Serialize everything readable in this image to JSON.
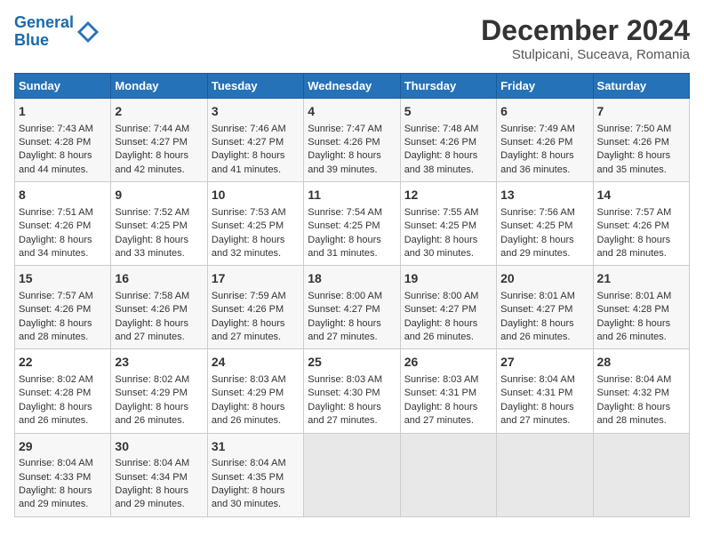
{
  "logo": {
    "line1": "General",
    "line2": "Blue"
  },
  "title": "December 2024",
  "subtitle": "Stulpicani, Suceava, Romania",
  "weekdays": [
    "Sunday",
    "Monday",
    "Tuesday",
    "Wednesday",
    "Thursday",
    "Friday",
    "Saturday"
  ],
  "weeks": [
    [
      {
        "day": "1",
        "lines": [
          "Sunrise: 7:43 AM",
          "Sunset: 4:28 PM",
          "Daylight: 8 hours",
          "and 44 minutes."
        ]
      },
      {
        "day": "2",
        "lines": [
          "Sunrise: 7:44 AM",
          "Sunset: 4:27 PM",
          "Daylight: 8 hours",
          "and 42 minutes."
        ]
      },
      {
        "day": "3",
        "lines": [
          "Sunrise: 7:46 AM",
          "Sunset: 4:27 PM",
          "Daylight: 8 hours",
          "and 41 minutes."
        ]
      },
      {
        "day": "4",
        "lines": [
          "Sunrise: 7:47 AM",
          "Sunset: 4:26 PM",
          "Daylight: 8 hours",
          "and 39 minutes."
        ]
      },
      {
        "day": "5",
        "lines": [
          "Sunrise: 7:48 AM",
          "Sunset: 4:26 PM",
          "Daylight: 8 hours",
          "and 38 minutes."
        ]
      },
      {
        "day": "6",
        "lines": [
          "Sunrise: 7:49 AM",
          "Sunset: 4:26 PM",
          "Daylight: 8 hours",
          "and 36 minutes."
        ]
      },
      {
        "day": "7",
        "lines": [
          "Sunrise: 7:50 AM",
          "Sunset: 4:26 PM",
          "Daylight: 8 hours",
          "and 35 minutes."
        ]
      }
    ],
    [
      {
        "day": "8",
        "lines": [
          "Sunrise: 7:51 AM",
          "Sunset: 4:26 PM",
          "Daylight: 8 hours",
          "and 34 minutes."
        ]
      },
      {
        "day": "9",
        "lines": [
          "Sunrise: 7:52 AM",
          "Sunset: 4:25 PM",
          "Daylight: 8 hours",
          "and 33 minutes."
        ]
      },
      {
        "day": "10",
        "lines": [
          "Sunrise: 7:53 AM",
          "Sunset: 4:25 PM",
          "Daylight: 8 hours",
          "and 32 minutes."
        ]
      },
      {
        "day": "11",
        "lines": [
          "Sunrise: 7:54 AM",
          "Sunset: 4:25 PM",
          "Daylight: 8 hours",
          "and 31 minutes."
        ]
      },
      {
        "day": "12",
        "lines": [
          "Sunrise: 7:55 AM",
          "Sunset: 4:25 PM",
          "Daylight: 8 hours",
          "and 30 minutes."
        ]
      },
      {
        "day": "13",
        "lines": [
          "Sunrise: 7:56 AM",
          "Sunset: 4:25 PM",
          "Daylight: 8 hours",
          "and 29 minutes."
        ]
      },
      {
        "day": "14",
        "lines": [
          "Sunrise: 7:57 AM",
          "Sunset: 4:26 PM",
          "Daylight: 8 hours",
          "and 28 minutes."
        ]
      }
    ],
    [
      {
        "day": "15",
        "lines": [
          "Sunrise: 7:57 AM",
          "Sunset: 4:26 PM",
          "Daylight: 8 hours",
          "and 28 minutes."
        ]
      },
      {
        "day": "16",
        "lines": [
          "Sunrise: 7:58 AM",
          "Sunset: 4:26 PM",
          "Daylight: 8 hours",
          "and 27 minutes."
        ]
      },
      {
        "day": "17",
        "lines": [
          "Sunrise: 7:59 AM",
          "Sunset: 4:26 PM",
          "Daylight: 8 hours",
          "and 27 minutes."
        ]
      },
      {
        "day": "18",
        "lines": [
          "Sunrise: 8:00 AM",
          "Sunset: 4:27 PM",
          "Daylight: 8 hours",
          "and 27 minutes."
        ]
      },
      {
        "day": "19",
        "lines": [
          "Sunrise: 8:00 AM",
          "Sunset: 4:27 PM",
          "Daylight: 8 hours",
          "and 26 minutes."
        ]
      },
      {
        "day": "20",
        "lines": [
          "Sunrise: 8:01 AM",
          "Sunset: 4:27 PM",
          "Daylight: 8 hours",
          "and 26 minutes."
        ]
      },
      {
        "day": "21",
        "lines": [
          "Sunrise: 8:01 AM",
          "Sunset: 4:28 PM",
          "Daylight: 8 hours",
          "and 26 minutes."
        ]
      }
    ],
    [
      {
        "day": "22",
        "lines": [
          "Sunrise: 8:02 AM",
          "Sunset: 4:28 PM",
          "Daylight: 8 hours",
          "and 26 minutes."
        ]
      },
      {
        "day": "23",
        "lines": [
          "Sunrise: 8:02 AM",
          "Sunset: 4:29 PM",
          "Daylight: 8 hours",
          "and 26 minutes."
        ]
      },
      {
        "day": "24",
        "lines": [
          "Sunrise: 8:03 AM",
          "Sunset: 4:29 PM",
          "Daylight: 8 hours",
          "and 26 minutes."
        ]
      },
      {
        "day": "25",
        "lines": [
          "Sunrise: 8:03 AM",
          "Sunset: 4:30 PM",
          "Daylight: 8 hours",
          "and 27 minutes."
        ]
      },
      {
        "day": "26",
        "lines": [
          "Sunrise: 8:03 AM",
          "Sunset: 4:31 PM",
          "Daylight: 8 hours",
          "and 27 minutes."
        ]
      },
      {
        "day": "27",
        "lines": [
          "Sunrise: 8:04 AM",
          "Sunset: 4:31 PM",
          "Daylight: 8 hours",
          "and 27 minutes."
        ]
      },
      {
        "day": "28",
        "lines": [
          "Sunrise: 8:04 AM",
          "Sunset: 4:32 PM",
          "Daylight: 8 hours",
          "and 28 minutes."
        ]
      }
    ],
    [
      {
        "day": "29",
        "lines": [
          "Sunrise: 8:04 AM",
          "Sunset: 4:33 PM",
          "Daylight: 8 hours",
          "and 29 minutes."
        ]
      },
      {
        "day": "30",
        "lines": [
          "Sunrise: 8:04 AM",
          "Sunset: 4:34 PM",
          "Daylight: 8 hours",
          "and 29 minutes."
        ]
      },
      {
        "day": "31",
        "lines": [
          "Sunrise: 8:04 AM",
          "Sunset: 4:35 PM",
          "Daylight: 8 hours",
          "and 30 minutes."
        ]
      },
      null,
      null,
      null,
      null
    ]
  ]
}
